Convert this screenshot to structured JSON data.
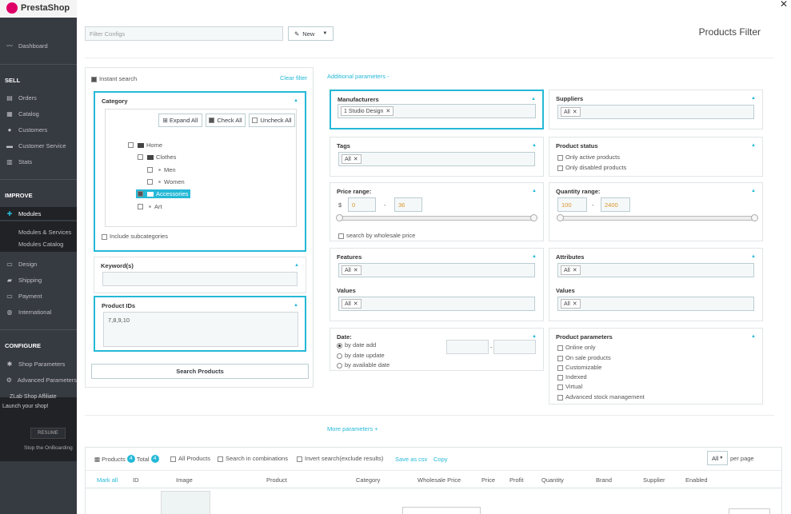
{
  "sidebar": {
    "logo": "PrestaShop",
    "dashboard": "Dashboard",
    "sell": "SELL",
    "orders": "Orders",
    "catalog": "Catalog",
    "customers": "Customers",
    "customer_service": "Customer Service",
    "stats": "Stats",
    "improve": "IMPROVE",
    "modules": "Modules",
    "modules_services": "Modules & Services",
    "modules_catalog": "Modules Catalog",
    "design": "Design",
    "shipping": "Shipping",
    "payment": "Payment",
    "international": "International",
    "configure": "CONFIGURE",
    "shop_parameters": "Shop Parameters",
    "advanced_parameters": "Advanced Parameters",
    "zlab": "ZLab Shop Affiliate",
    "launch": "Launch your shop!",
    "resume": "RESUME",
    "stop": "Stop the OnBoarding"
  },
  "top": {
    "filter_placeholder": "Filter Configs",
    "new_label": "New",
    "title": "Products Filter"
  },
  "left": {
    "instant_search": "Instant search",
    "clear_filter": "Clear filter",
    "category_title": "Category",
    "expand_all": "Expand All",
    "check_all": "Check All",
    "uncheck_all": "Uncheck All",
    "tree": {
      "home": "Home",
      "clothes": "Clothes",
      "men": "Men",
      "women": "Women",
      "accessories": "Accessories",
      "art": "Art"
    },
    "include_sub": "Include subcategories",
    "keywords_title": "Keyword(s)",
    "product_ids_title": "Product IDs",
    "product_ids_value": "7,8,9,10",
    "search_products": "Search Products"
  },
  "right": {
    "additional_params": "Additional parameters -",
    "manufacturers": "Manufacturers",
    "manufacturer_tag": "1 Studio Design",
    "suppliers": "Suppliers",
    "all": "All",
    "tags": "Tags",
    "product_status": "Product status",
    "only_active": "Only active products",
    "only_disabled": "Only disabled products",
    "price_range": "Price range:",
    "currency": "$",
    "price_min": "0",
    "price_max": "36",
    "dash": "-",
    "quantity_range": "Quantity range:",
    "qty_min": "100",
    "qty_max": "2400",
    "wholesale": "search by wholesale price",
    "features": "Features",
    "values": "Values",
    "attributes": "Attributes",
    "date": "Date:",
    "by_date_add": "by date add",
    "by_date_update": "by date update",
    "by_available_date": "by available date",
    "product_parameters": "Product parameters",
    "online_only": "Online only",
    "on_sale": "On sale products",
    "customizable": "Customizable",
    "indexed": "Indexed",
    "virtual": "Virtual",
    "advanced_stock": "Advanced stock management",
    "more_params": "More parameters +"
  },
  "results": {
    "products_label": "Products",
    "products_count": "4",
    "total_label": "Total",
    "total_count": "4",
    "all_products": "All Products",
    "search_combinations": "Search in combinations",
    "invert_search": "Invert search(exclude results)",
    "save_csv": "Save as csv",
    "copy": "Copy",
    "per_page_value": "All",
    "per_page_label": "per page",
    "columns": [
      "Mark all",
      "ID",
      "Image",
      "Product",
      "Category",
      "Wholesale Price",
      "Price",
      "Profit",
      "Quantity",
      "Brand",
      "Supplier",
      "Enabled"
    ]
  },
  "colors": {
    "accent": "#25b9d7",
    "sidebar": "#363a41"
  }
}
